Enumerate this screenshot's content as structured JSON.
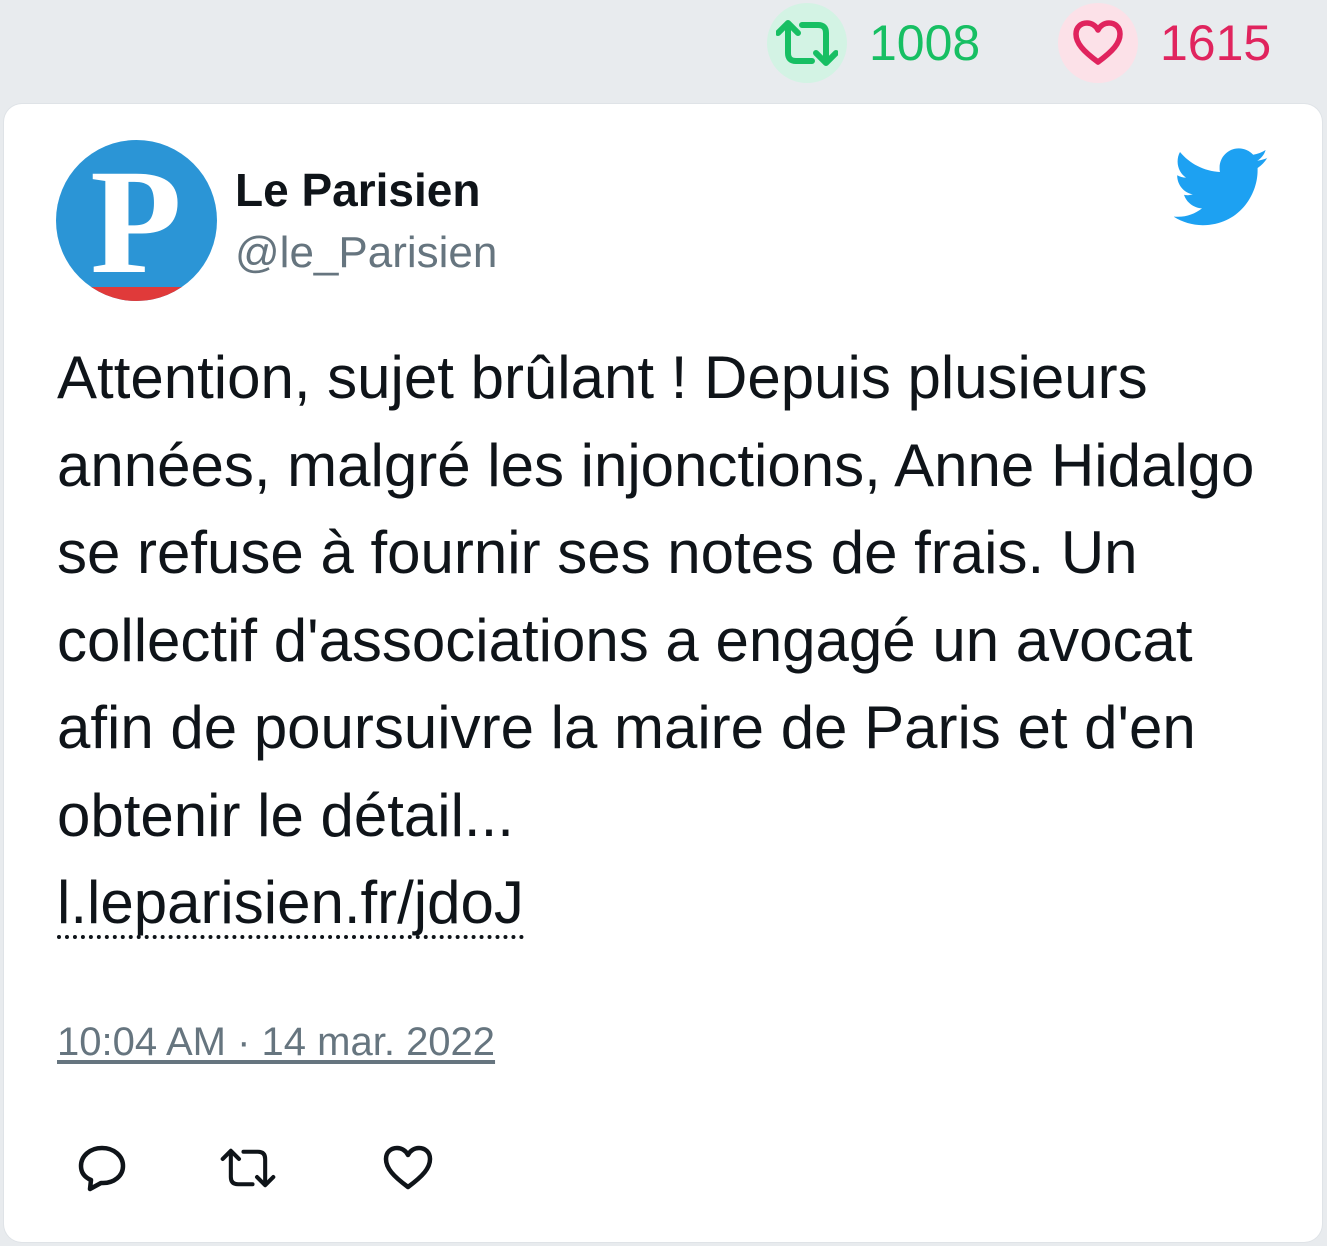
{
  "stats": {
    "retweets": "1008",
    "likes": "1615",
    "retweet_icon": "retweet-icon",
    "like_icon": "heart-icon",
    "retweet_color": "#17bf63",
    "like_color": "#e0245e"
  },
  "tweet": {
    "author_name": "Le Parisien",
    "author_handle": "@le_Parisien",
    "avatar_letter": "P",
    "text": "Attention, sujet brûlant ! Depuis plusieurs années, malgré les injonctions, Anne Hidalgo se refuse à fournir ses notes de frais. Un collectif d'associations a engagé un avocat afin de poursuivre la maire de Paris et d'en obtenir le détail...",
    "link": "l.leparisien.fr/jdoJ",
    "timestamp": "10:04 AM · 14 mar. 2022",
    "brand_icon": "twitter-bird-icon",
    "brand_color": "#1da1f2",
    "avatar_color": "#2b95d6",
    "avatar_accent": "#e03a3a"
  },
  "actions": [
    {
      "icon": "reply-icon"
    },
    {
      "icon": "retweet-icon"
    },
    {
      "icon": "heart-icon"
    }
  ]
}
